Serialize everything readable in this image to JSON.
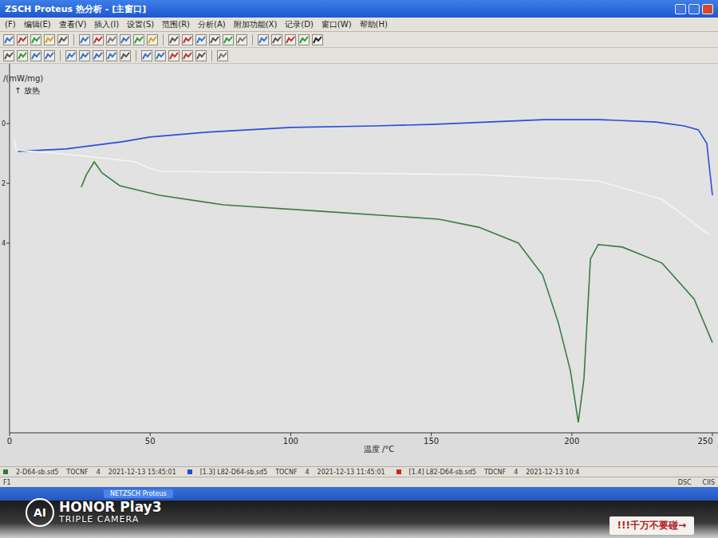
{
  "window": {
    "title": "ZSCH Proteus 热分析 - [主窗口]"
  },
  "menu": [
    "(F)",
    "编辑(E)",
    "查看(V)",
    "插入(I)",
    "设置(S)",
    "范围(R)",
    "分析(A)",
    "附加功能(X)",
    "记录(D)",
    "窗口(W)",
    "帮助(H)"
  ],
  "chart": {
    "y_axis": {
      "label": "/(mW/mg)",
      "sub_label": "↑ 放热",
      "ticks": [
        {
          "label": "0",
          "value": 0
        },
        {
          "label": "2",
          "value": -0.2
        },
        {
          "label": "4",
          "value": -0.4
        }
      ]
    },
    "x_axis": {
      "title": "温度 /°C",
      "ticks": [
        "0",
        "50",
        "100",
        "150",
        "200",
        "250"
      ]
    },
    "series": [
      {
        "name": "blue",
        "color": "#2a4fd6",
        "x": [
          3,
          20,
          40,
          50,
          70,
          100,
          130,
          150,
          170,
          190,
          210,
          230,
          240,
          245,
          248,
          250
        ],
        "values": [
          -0.093,
          -0.085,
          -0.061,
          -0.045,
          -0.029,
          -0.013,
          -0.008,
          -0.003,
          0.005,
          0.013,
          0.013,
          0.005,
          -0.008,
          -0.021,
          -0.067,
          -0.24
        ]
      },
      {
        "name": "white",
        "color": "#f4f4f4",
        "x": [
          1.7,
          2.3,
          25,
          44.8,
          49.1,
          53.3,
          110,
          167,
          209.4,
          232,
          249
        ],
        "values": [
          -0.053,
          -0.088,
          -0.107,
          -0.128,
          -0.147,
          -0.16,
          -0.165,
          -0.171,
          -0.192,
          -0.253,
          -0.373
        ]
      },
      {
        "name": "green",
        "color": "#3c7a46",
        "x": [
          25.5,
          27.2,
          30.1,
          32.9,
          39.2,
          53.3,
          76.1,
          110.1,
          152.7,
          166.9,
          181,
          189.6,
          195.2,
          199.5,
          202.3,
          204.3,
          206.6,
          209.4,
          217.9,
          232.1,
          243.5,
          250
        ],
        "values": [
          -0.213,
          -0.173,
          -0.128,
          -0.165,
          -0.208,
          -0.24,
          -0.272,
          -0.293,
          -0.32,
          -0.347,
          -0.4,
          -0.507,
          -0.667,
          -0.827,
          -1.0,
          -0.853,
          -0.453,
          -0.405,
          -0.413,
          -0.467,
          -0.587,
          -0.733
        ]
      }
    ]
  },
  "status": {
    "entries": [
      {
        "label": "2-D64-sb.sd5",
        "type": "TOCNF",
        "num": "4",
        "time": "2021-12-13 15:45:01",
        "color": "#2a7a3a"
      },
      {
        "label": "[1.3] L82-D64-sb.sd5",
        "type": "TOCNF",
        "num": "4",
        "time": "2021-12-13 11:45:01",
        "color": "#1f4fd0"
      },
      {
        "label": "[1.4] L82-D64-sb.sd5",
        "type": "TDCNF",
        "num": "4",
        "time": "2021-12-13 10:4",
        "color": "#cc2222"
      }
    ],
    "hint": "F1",
    "right": [
      "DSC",
      "CIIS"
    ]
  },
  "taskbar": {
    "buttons": [
      "NETZSCH Proteus"
    ]
  },
  "watermark": {
    "logo": "AI",
    "brand": "HONOR Play3",
    "sub": "TRIPLE CAMERA"
  },
  "notes": [
    "!!!千万不要碰→"
  ]
}
